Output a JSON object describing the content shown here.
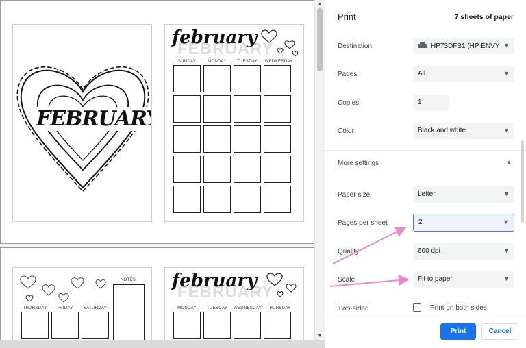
{
  "preview": {
    "page1_title": "FEBRUARY",
    "page2_title": "february",
    "page2_ghost": "FEBRUARY",
    "page2_days": [
      "SUNDAY",
      "MONDAY",
      "TUESDAY",
      "WEDNESDAY"
    ],
    "page3_days": [
      "THURSDAY",
      "FRIDAY",
      "SATURDAY"
    ],
    "page3_notes": "NOTES",
    "page4_title": "february",
    "page4_ghost": "FEBRUARY",
    "page4_days": [
      "MONDAY",
      "TUESDAY",
      "WEDNESDAY",
      "THURSDAY"
    ]
  },
  "panel": {
    "title": "Print",
    "sheets": "7 sheets of paper",
    "destination": {
      "label": "Destination",
      "value": "HP73DFB1 (HP ENVY"
    },
    "pages": {
      "label": "Pages",
      "value": "All"
    },
    "copies": {
      "label": "Copies",
      "value": "1"
    },
    "color": {
      "label": "Color",
      "value": "Black and white"
    },
    "more_settings": "More settings",
    "paper_size": {
      "label": "Paper size",
      "value": "Letter"
    },
    "pages_per_sheet": {
      "label": "Pages per sheet",
      "value": "2"
    },
    "quality": {
      "label": "Quality",
      "value": "600 dpi"
    },
    "scale": {
      "label": "Scale",
      "value": "Fit to paper"
    },
    "two_sided": {
      "label": "Two-sided",
      "option": "Print on both sides"
    },
    "print_button": "Print",
    "cancel_button": "Cancel"
  },
  "colors": {
    "accent": "#1a73e8",
    "annotation_arrow": "#e98ac8"
  }
}
